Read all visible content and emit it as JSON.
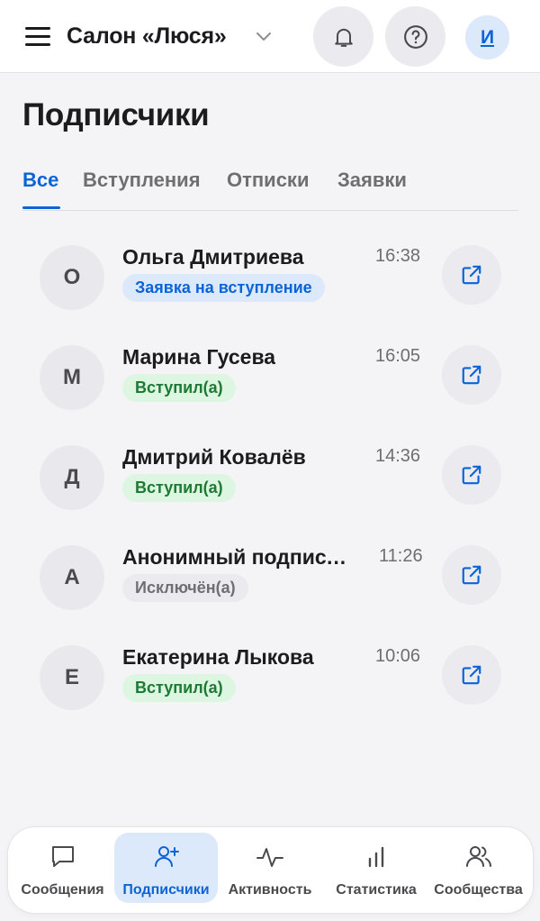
{
  "header": {
    "group_name": "Салон «Люся»",
    "avatar_letter": "И"
  },
  "page": {
    "title": "Подписчики"
  },
  "tabs": [
    {
      "label": "Все",
      "active": true
    },
    {
      "label": "Вступления",
      "active": false
    },
    {
      "label": "Отписки",
      "active": false
    },
    {
      "label": "Заявки",
      "active": false
    }
  ],
  "subscribers": [
    {
      "initial": "О",
      "name": "Ольга Дмитриева",
      "time": "16:38",
      "status": "Заявка на вступление",
      "status_type": "request"
    },
    {
      "initial": "М",
      "name": "Марина Гусева",
      "time": "16:05",
      "status": "Вступил(а)",
      "status_type": "joined"
    },
    {
      "initial": "Д",
      "name": "Дмитрий Ковалёв",
      "time": "14:36",
      "status": "Вступил(а)",
      "status_type": "joined"
    },
    {
      "initial": "А",
      "name": "Анонимный подписчик",
      "time": "11:26",
      "status": "Исключён(а)",
      "status_type": "excluded"
    },
    {
      "initial": "Е",
      "name": "Екатерина Лыкова",
      "time": "10:06",
      "status": "Вступил(а)",
      "status_type": "joined"
    }
  ],
  "bottom_nav": [
    {
      "label": "Сообщения",
      "icon": "message-icon",
      "active": false
    },
    {
      "label": "Подписчики",
      "icon": "user-plus-icon",
      "active": true
    },
    {
      "label": "Активность",
      "icon": "activity-icon",
      "active": false
    },
    {
      "label": "Статистика",
      "icon": "bar-chart-icon",
      "active": false
    },
    {
      "label": "Сообщества",
      "icon": "users-icon",
      "active": false
    }
  ],
  "colors": {
    "accent": "#0a64d8",
    "background": "#f4f4f6",
    "badge_request_bg": "#dce9fa",
    "badge_joined_bg": "#ddf6e2",
    "badge_joined_text": "#1d7a33",
    "badge_excluded_bg": "#ebebef"
  }
}
